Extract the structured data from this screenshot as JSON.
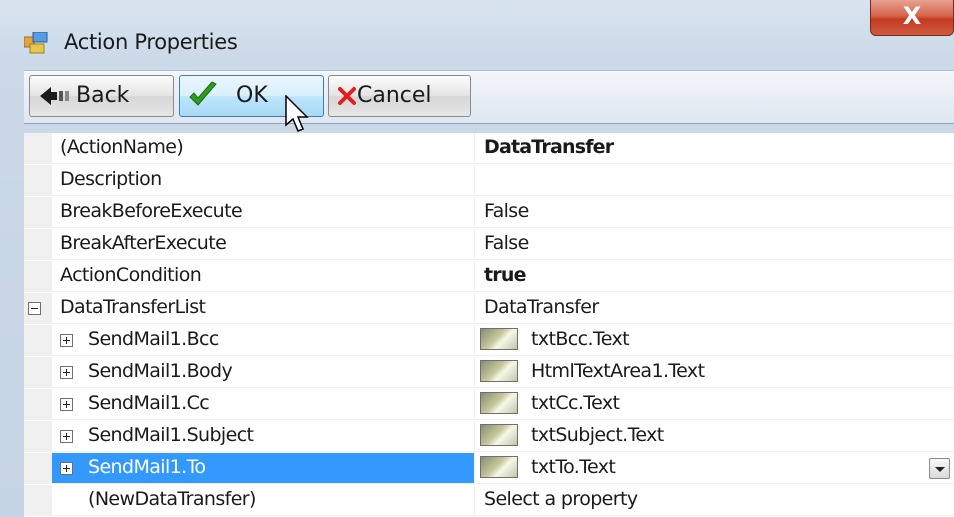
{
  "window": {
    "title": "Action Properties",
    "close_glyph": "X"
  },
  "toolbar": {
    "back_label": "Back",
    "ok_label": "OK",
    "cancel_label": "Cancel"
  },
  "icons": {
    "back": "arrow-back-icon",
    "ok": "green-checkmark-icon",
    "cancel": "red-x-icon",
    "item": "item-thumbnail-icon",
    "expand": "plus-box-icon",
    "collapse": "minus-box-icon",
    "dropdown": "dropdown-arrow-icon"
  },
  "colors": {
    "selection": "#3399ff",
    "close_button": "#c43b22",
    "ok_check": "#2e9b1f",
    "cancel_x": "#e02020"
  },
  "grid": {
    "rows": [
      {
        "name": "(ActionName)",
        "value": "DataTransfer"
      },
      {
        "name": "Description",
        "value": ""
      },
      {
        "name": "BreakBeforeExecute",
        "value": "False"
      },
      {
        "name": "BreakAfterExecute",
        "value": "False"
      },
      {
        "name": "ActionCondition",
        "value": "true"
      },
      {
        "name": "DataTransferList",
        "value": "DataTransfer"
      },
      {
        "name": "SendMail1.Bcc",
        "value": "txtBcc.Text"
      },
      {
        "name": "SendMail1.Body",
        "value": "HtmlTextArea1.Text"
      },
      {
        "name": "SendMail1.Cc",
        "value": "txtCc.Text"
      },
      {
        "name": "SendMail1.Subject",
        "value": "txtSubject.Text"
      },
      {
        "name": "SendMail1.To",
        "value": "txtTo.Text"
      },
      {
        "name": "(NewDataTransfer)",
        "value": "Select a property"
      }
    ]
  }
}
